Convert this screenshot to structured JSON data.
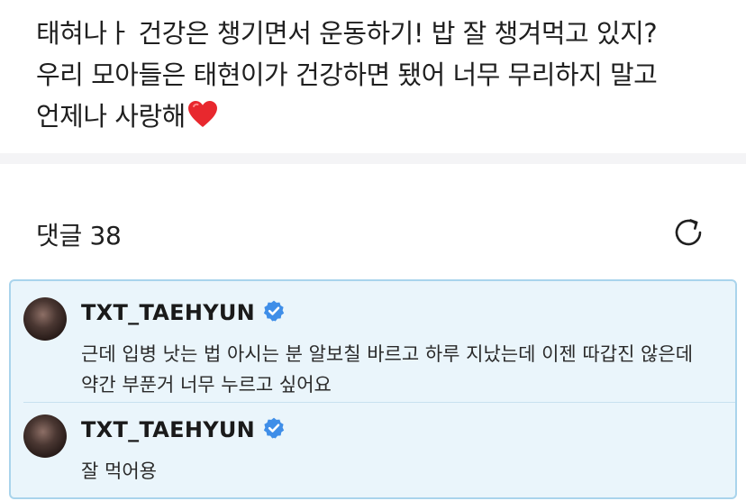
{
  "post": {
    "lines": [
      "태혀나ㅏ 건강은 챙기면서 운동하기! 밥 잘 챙겨먹고 있지?",
      "우리 모아들은 태현이가 건강하면 됐어 너무 무리하지 말고",
      "언제나 사랑해"
    ],
    "emoji_icon": "red-heart-icon"
  },
  "comments_section": {
    "title": "댓글 38",
    "refresh_icon": "refresh-icon"
  },
  "comments": [
    {
      "author": "TXT_TAEHYUN",
      "verified": true,
      "text": "근데 입병 낫는 법 아시는 분 알보칠 바르고 하루 지났는데 이젠 따갑진 않은데 약간 부푼거 너무 누르고 싶어요"
    },
    {
      "author": "TXT_TAEHYUN",
      "verified": true,
      "text": "잘 먹어용"
    }
  ],
  "colors": {
    "highlight_bg": "#eaf5fb",
    "highlight_border": "#a9d4ec",
    "verified_blue": "#3f8ee8",
    "heart_red": "#e8282e"
  }
}
